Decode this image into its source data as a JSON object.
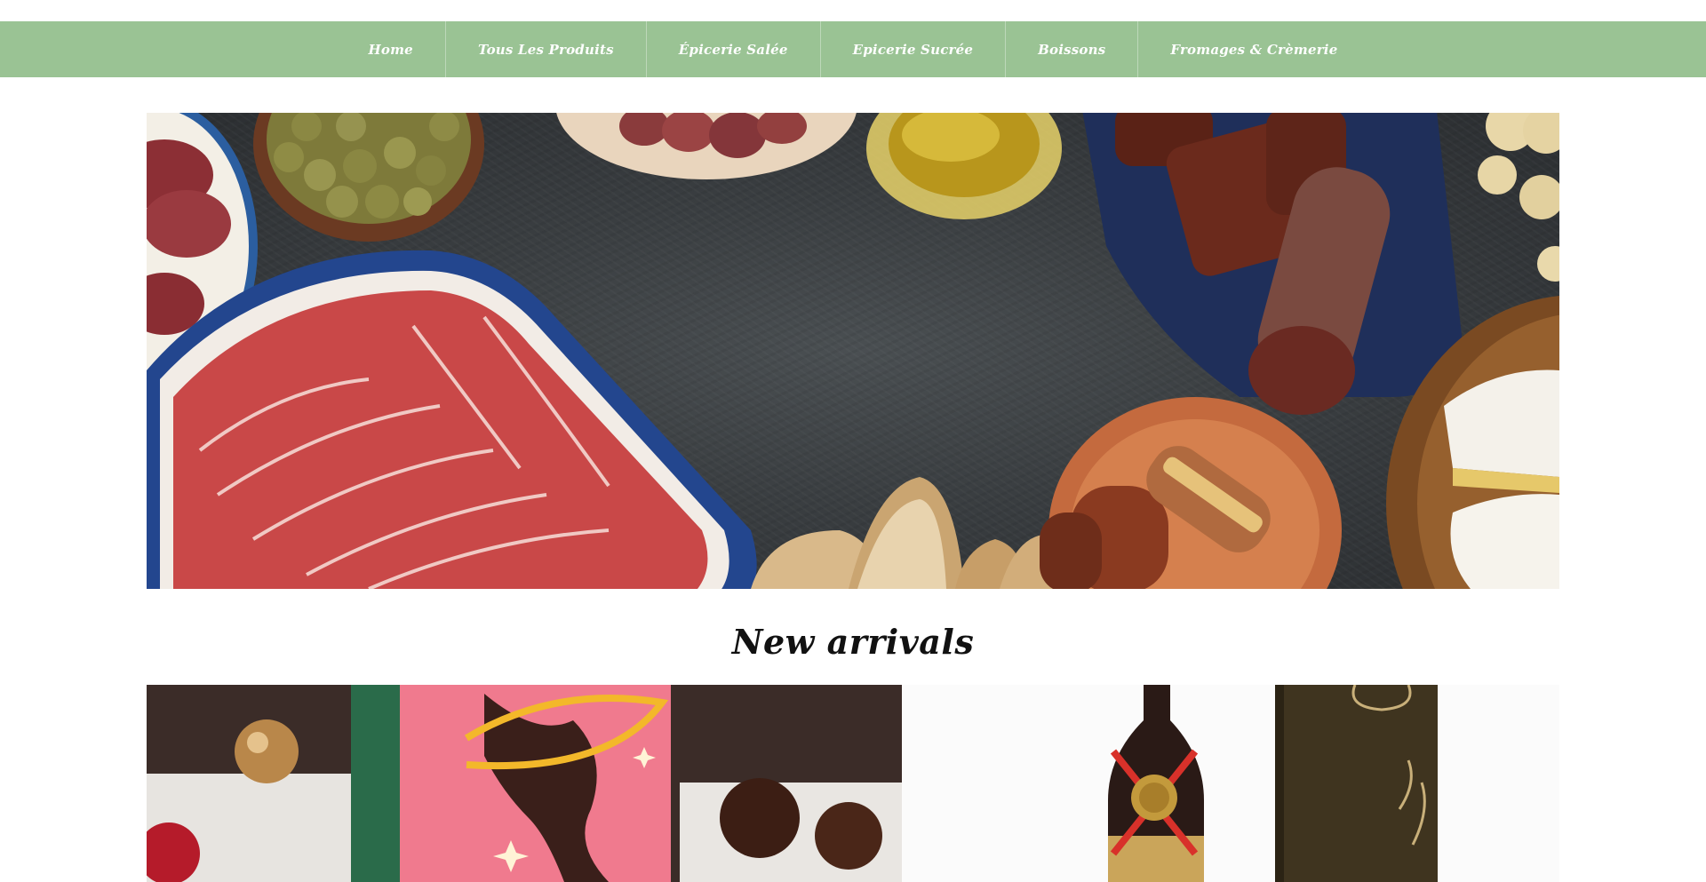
{
  "nav": {
    "items": [
      {
        "label": "Home"
      },
      {
        "label": "Tous Les Produits"
      },
      {
        "label": "Épicerie Salée"
      },
      {
        "label": "Epicerie Sucrée"
      },
      {
        "label": "Boissons"
      },
      {
        "label": "Fromages & Crèmerie"
      }
    ]
  },
  "hero": {
    "image": "charcuterie-board-image"
  },
  "new_arrivals": {
    "title": "New arrivals",
    "products": [
      {
        "image": "chocolate-bag-product-image"
      },
      {
        "image": "wine-bottle-gift-box-image"
      }
    ]
  },
  "colors": {
    "nav_bg": "#9ac394",
    "nav_text": "#ffffff",
    "title_text": "#111111"
  }
}
